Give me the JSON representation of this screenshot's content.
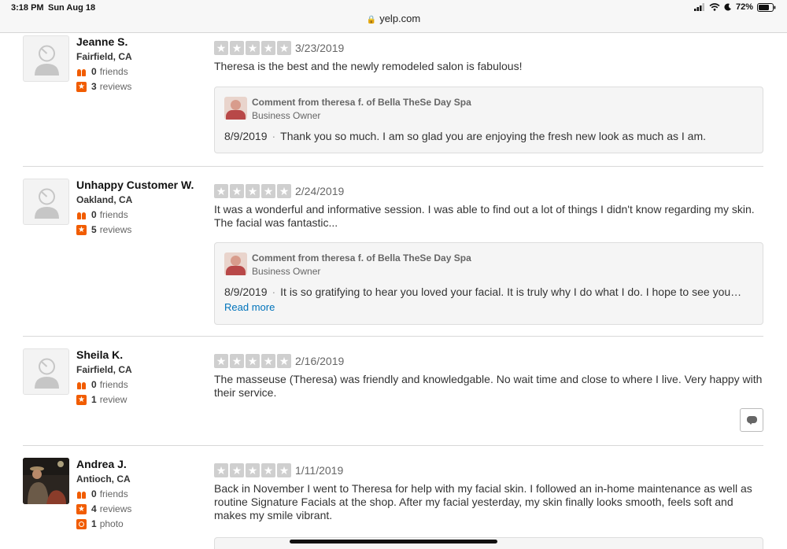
{
  "status_bar": {
    "time": "3:18 PM",
    "date": "Sun Aug 18",
    "battery": "72%",
    "url": "yelp.com"
  },
  "reviews": [
    {
      "name": "Jeanne S.",
      "location": "Fairfield, CA",
      "friends_count": "0",
      "friends_label": "friends",
      "reviews_count": "3",
      "reviews_label": "reviews",
      "rating": 5,
      "date": "3/23/2019",
      "text": "Theresa is the best and the newly remodeled salon is fabulous!",
      "reply": {
        "title": "Comment from theresa f. of Bella TheSe Day Spa",
        "role": "Business Owner",
        "date": "8/9/2019",
        "text": "Thank you so much. I am so glad you are enjoying the fresh new look as much as I am."
      }
    },
    {
      "name": "Unhappy Customer W.",
      "location": "Oakland, CA",
      "friends_count": "0",
      "friends_label": "friends",
      "reviews_count": "5",
      "reviews_label": "reviews",
      "rating": 5,
      "date": "2/24/2019",
      "text": "It was a wonderful and informative session.  I was able to find out a lot of things I didn't know regarding my skin.  The facial was fantastic...",
      "reply": {
        "title": "Comment from theresa f. of Bella TheSe Day Spa",
        "role": "Business Owner",
        "date": "8/9/2019",
        "text": "It is so gratifying to hear you loved your facial. It is truly why I do what I do. I hope to see you…",
        "read_more": "Read more"
      }
    },
    {
      "name": "Sheila K.",
      "location": "Fairfield, CA",
      "friends_count": "0",
      "friends_label": "friends",
      "reviews_count": "1",
      "reviews_label": "review",
      "rating": 5,
      "date": "2/16/2019",
      "text": "The masseuse (Theresa) was friendly and knowledgable.  No wait time and close to where I live.  Very happy with their service."
    },
    {
      "name": "Andrea J.",
      "location": "Antioch, CA",
      "friends_count": "0",
      "friends_label": "friends",
      "reviews_count": "4",
      "reviews_label": "reviews",
      "photos_count": "1",
      "photos_label": "photo",
      "rating": 5,
      "date": "1/11/2019",
      "text": "Back in November I went to Theresa for help with my facial skin.  I followed an in-home maintenance as well as routine Signature Facials at the shop.  After my facial yesterday, my skin finally looks smooth, feels soft and makes my smile vibrant."
    }
  ],
  "colors": {
    "accent": "#f15c00",
    "star_empty": "#cfcfcf",
    "link": "#0073bb"
  }
}
